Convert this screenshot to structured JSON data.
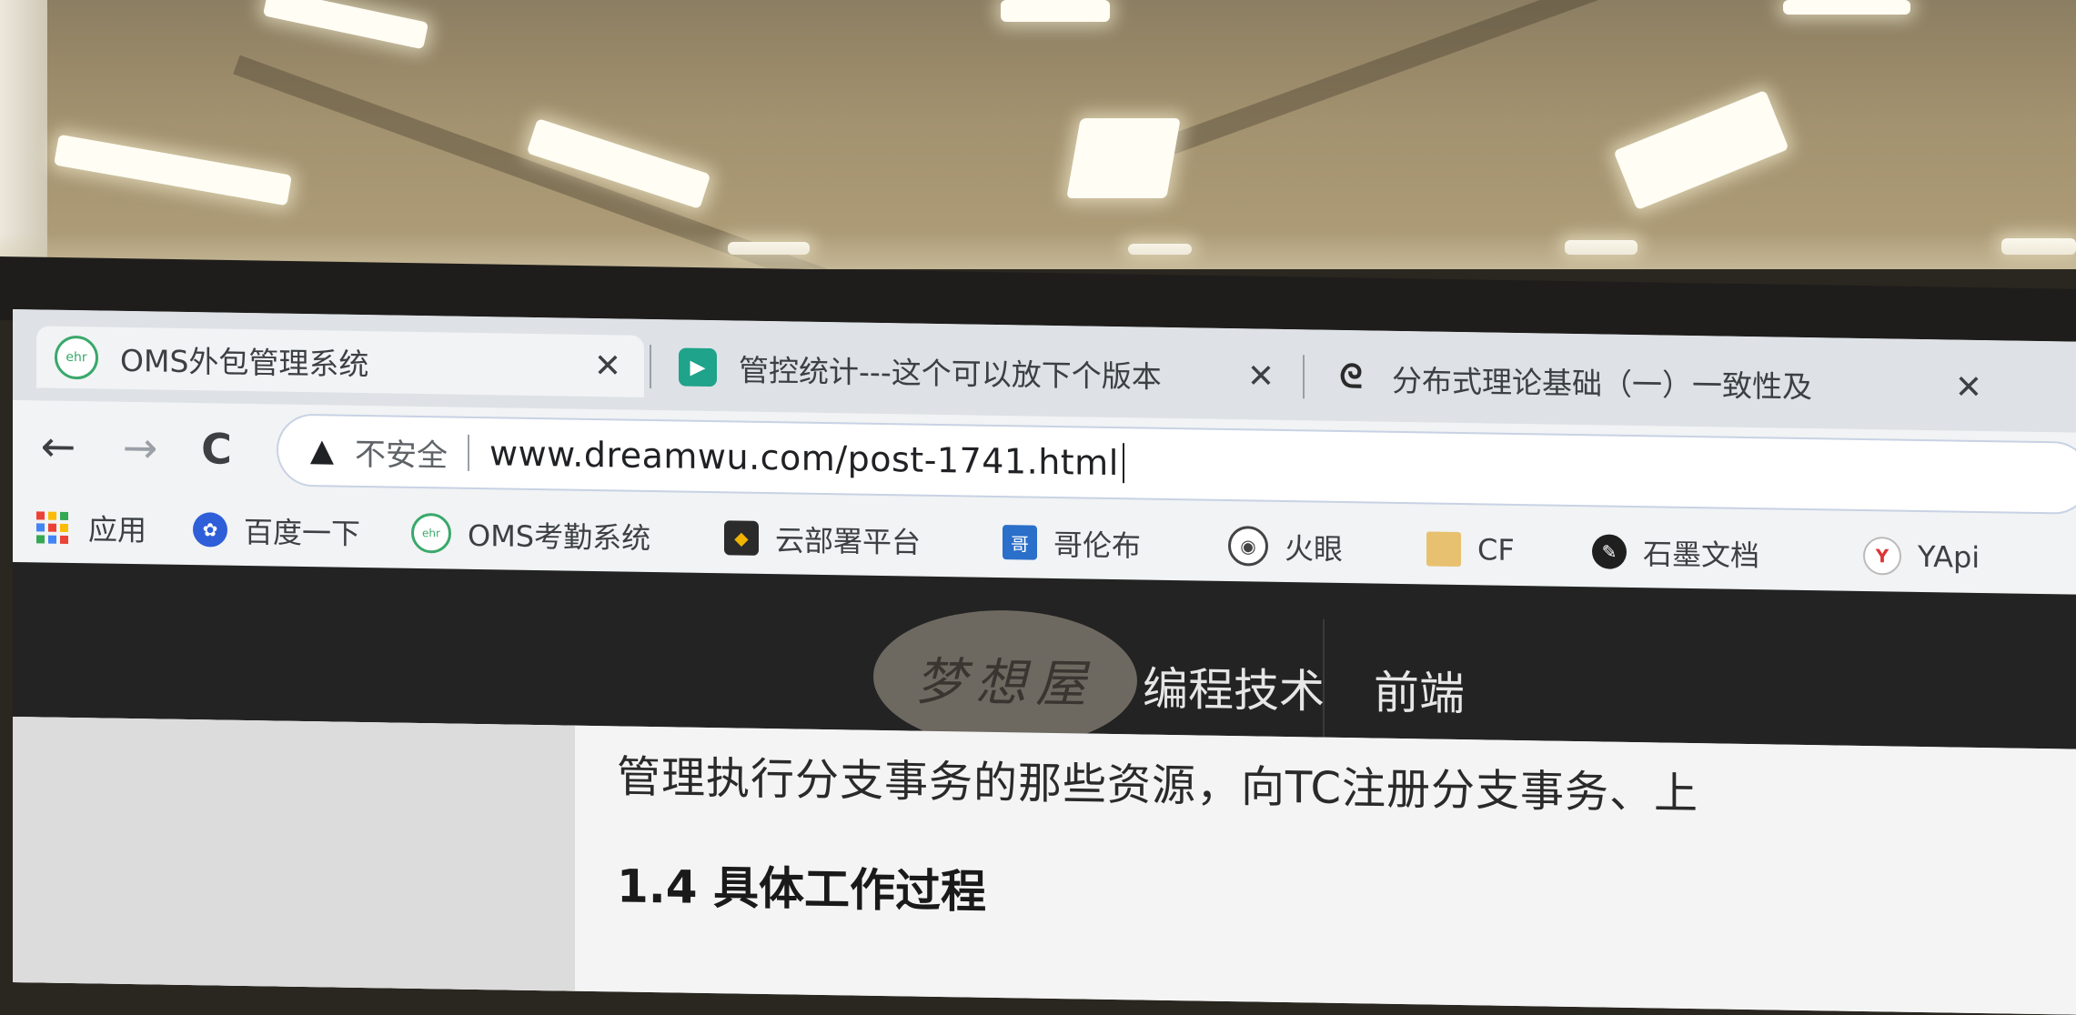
{
  "browser": {
    "tabs": [
      {
        "title": "OMS外包管理系统",
        "icon": "oms-logo-icon",
        "icon_text": "ehr",
        "active": true
      },
      {
        "title": "管控统计---这个可以放下个版本",
        "icon": "play-icon",
        "active": false
      },
      {
        "title": "分布式理论基础（一）一致性及",
        "icon": "dream-logo-icon",
        "active": false
      }
    ],
    "close_glyph": "✕",
    "toolbar": {
      "back": "←",
      "forward": "→",
      "reload": "C",
      "security_warning": "不安全",
      "url": "www.dreamwu.com/post-1741.html"
    },
    "bookmarks": [
      {
        "label": "应用",
        "icon": "apps-grid-icon"
      },
      {
        "label": "百度一下",
        "icon": "baidu-paw-icon"
      },
      {
        "label": "OMS考勤系统",
        "icon": "oms-logo-icon"
      },
      {
        "label": "云部署平台",
        "icon": "cloud-deploy-icon"
      },
      {
        "label": "哥伦布",
        "icon": "columbus-icon"
      },
      {
        "label": "火眼",
        "icon": "eye-icon"
      },
      {
        "label": "CF",
        "icon": "folder-icon"
      },
      {
        "label": "石墨文档",
        "icon": "shimo-icon"
      },
      {
        "label": "YApi",
        "icon": "yapi-icon"
      }
    ]
  },
  "site": {
    "logo_text": "梦想屋",
    "nav": [
      "编程技术",
      "前端"
    ],
    "paragraph": "管理执行分支事务的那些资源，向TC注册分支事务、上",
    "heading": "1.4 具体工作过程"
  },
  "colors": {
    "tab_strip": "#dee1e6",
    "toolbar": "#f1f3f4",
    "site_header": "#232323",
    "oms_green": "#3aa86b",
    "play_teal": "#1fa38a"
  }
}
